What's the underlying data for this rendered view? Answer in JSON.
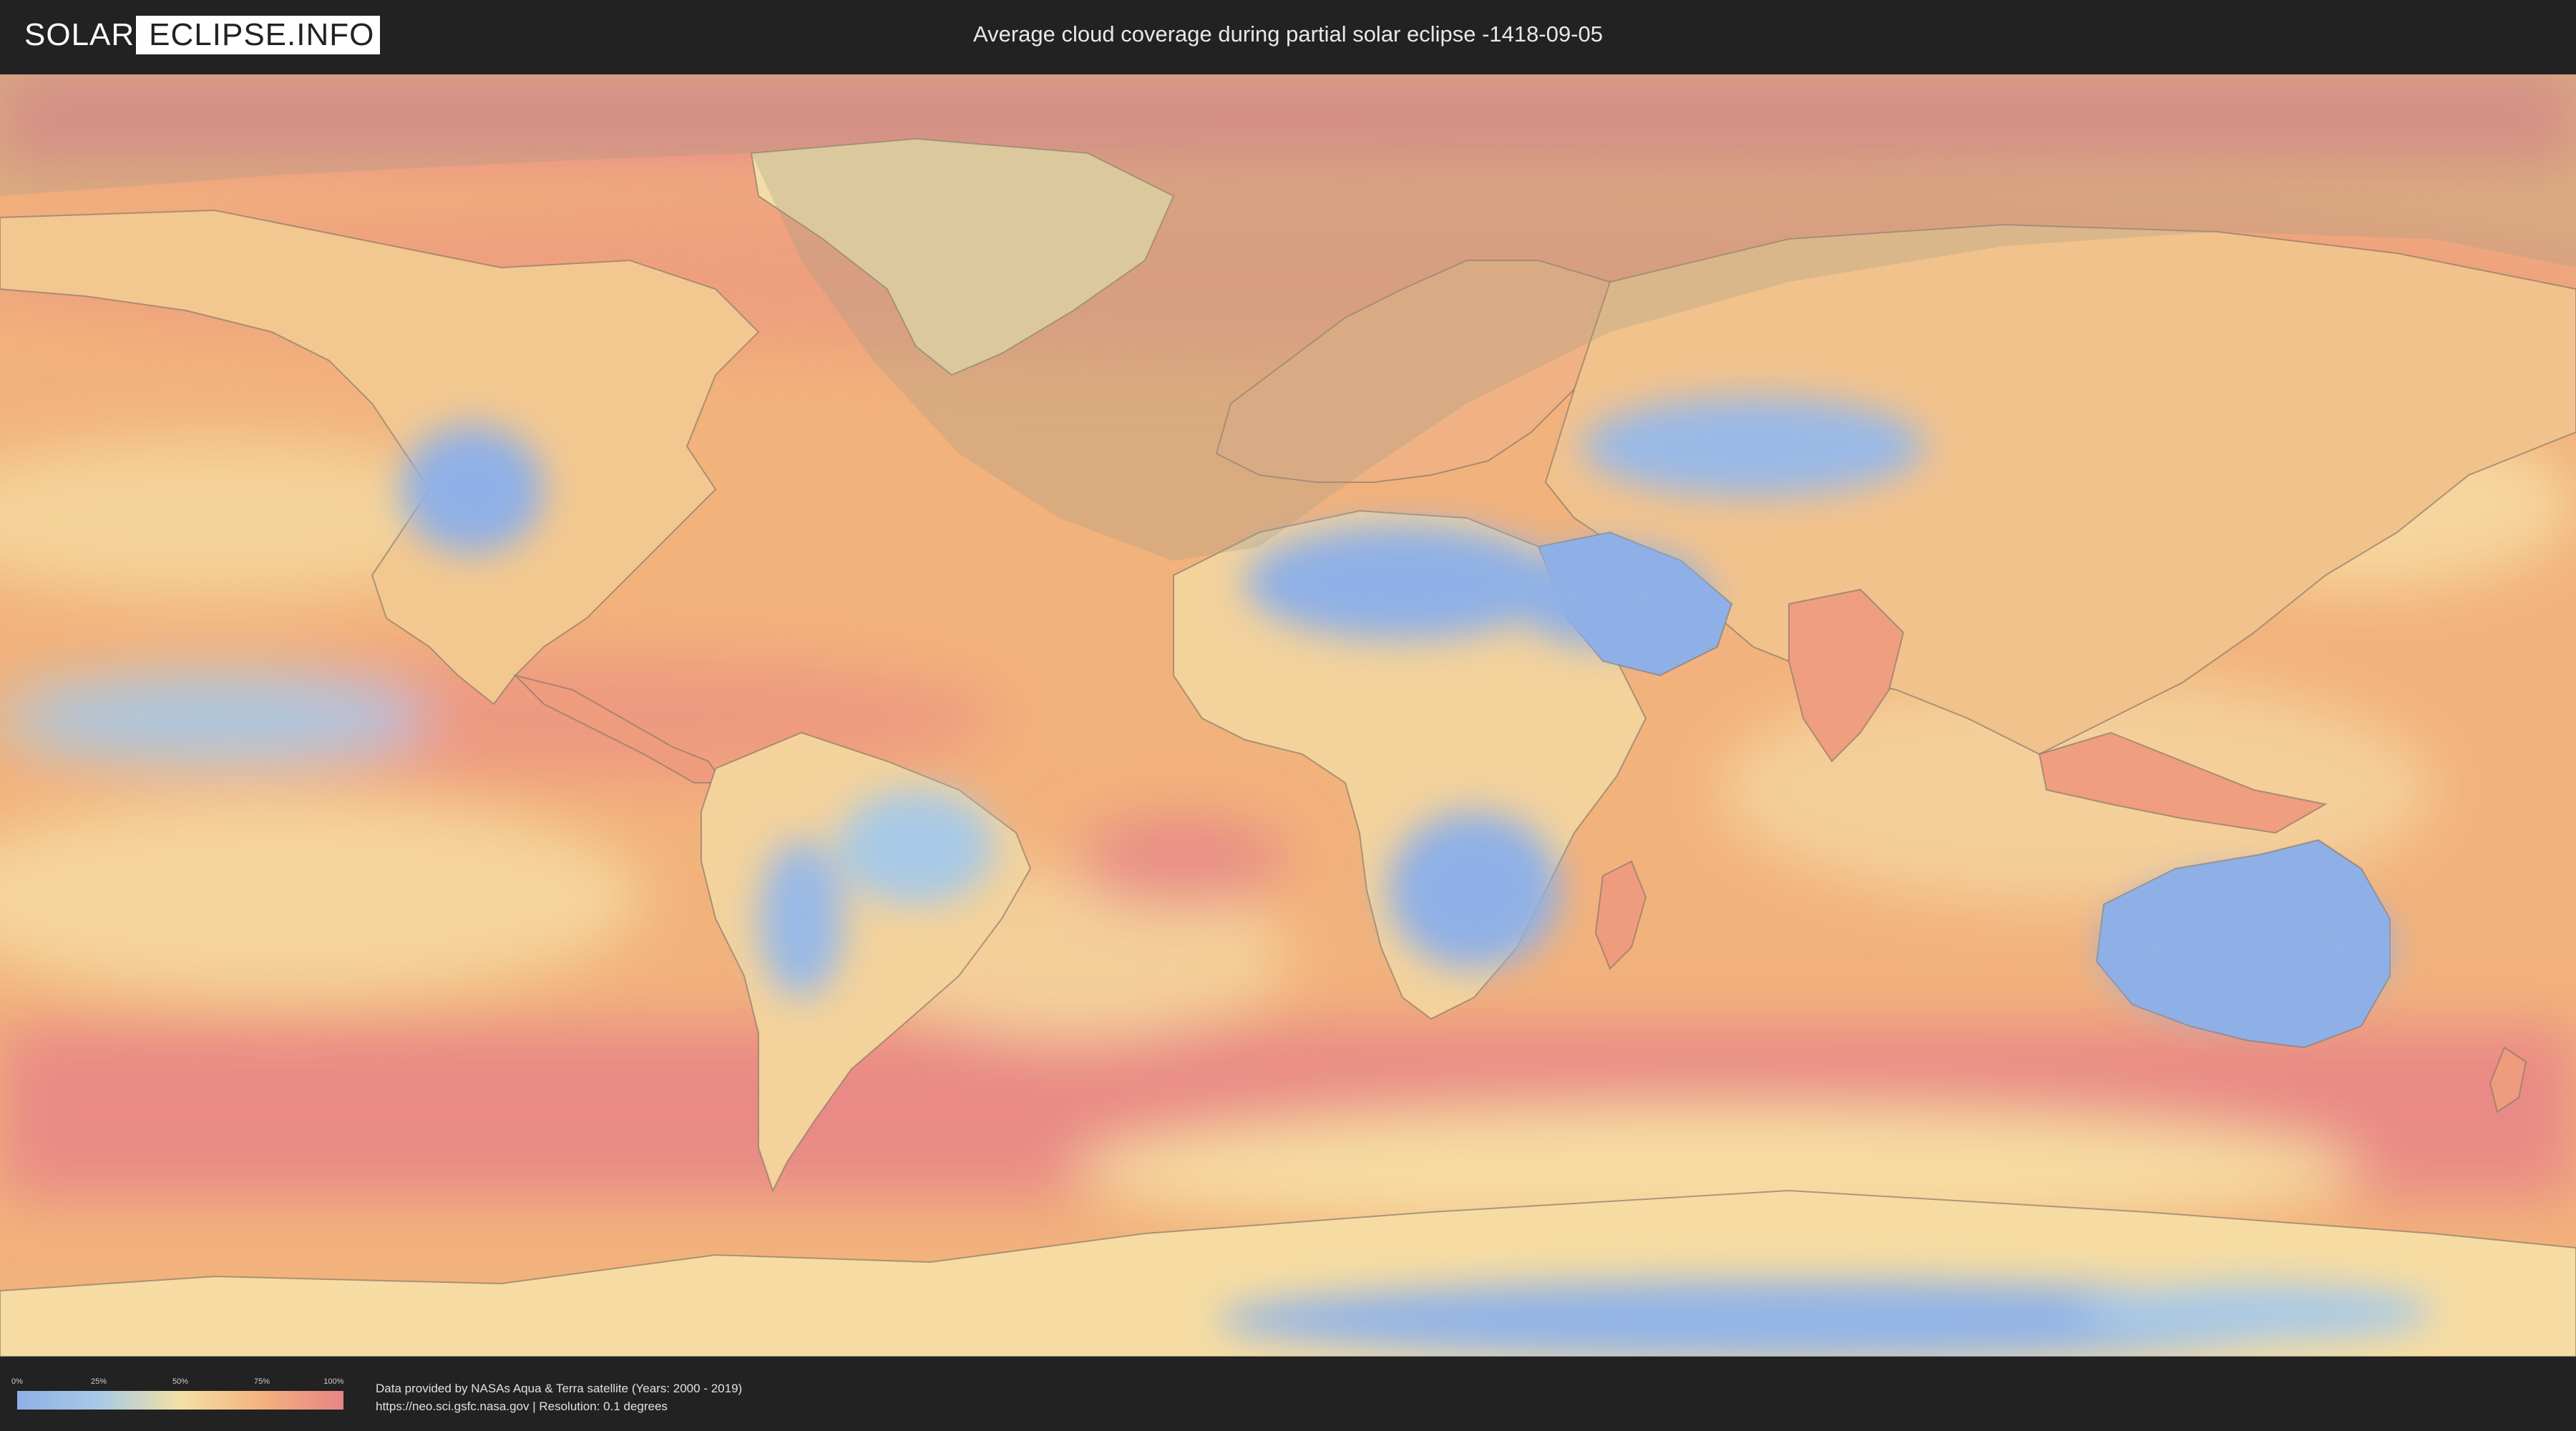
{
  "header": {
    "logo_left": "SOLAR",
    "logo_right": "ECLIPSE.INFO",
    "title": "Average cloud coverage during partial solar eclipse -1418-09-05"
  },
  "legend": {
    "ticks": [
      "0%",
      "25%",
      "50%",
      "75%",
      "100%"
    ],
    "colors": [
      "#8fb0e6",
      "#a8c9e6",
      "#f3e0a6",
      "#f3b27f",
      "#e88484"
    ]
  },
  "footer": {
    "attribution_line1": "Data provided by NASAs Aqua & Terra satellite (Years: 2000 - 2019)",
    "attribution_line2": "https://neo.sci.gsfc.nasa.gov | Resolution: 0.1 degrees"
  },
  "map": {
    "layer": "average cloud coverage",
    "overlay": "eclipse visibility zone",
    "colors": {
      "clear": "#8fb0e6",
      "low": "#a8c9e6",
      "medium": "#f3e0a6",
      "high": "#f3b27f",
      "overcast": "#e88484",
      "border": "#8a7a6a",
      "eclipse_shade": "#9e9a8a"
    }
  }
}
